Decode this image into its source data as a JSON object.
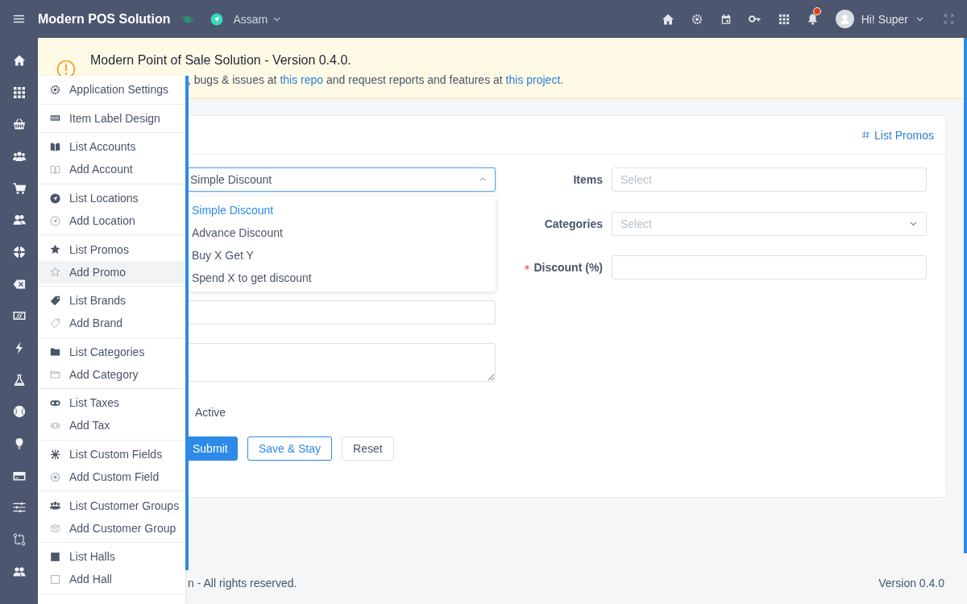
{
  "topbar": {
    "app_title": "Modern POS Solution",
    "location": "Assam",
    "user_greeting": "Hi! Super",
    "notifications_unread": true
  },
  "alert": {
    "title": "Modern Point of Sale Solution - Version 0.4.0.",
    "message": [
      {
        "kind": "text",
        "text": ", bugs & issues at "
      },
      {
        "kind": "link",
        "text": "this repo"
      },
      {
        "kind": "text",
        "text": " and request reports and features at "
      },
      {
        "kind": "link",
        "text": "this project"
      },
      {
        "kind": "text",
        "text": "."
      }
    ]
  },
  "menu": {
    "groups": [
      {
        "items": [
          {
            "label": "Application Settings",
            "selected": false
          }
        ]
      },
      {
        "items": [
          {
            "label": "Item Label Design",
            "selected": false
          }
        ]
      },
      {
        "items": [
          {
            "label": "List Accounts",
            "selected": false
          },
          {
            "label": "Add Account",
            "selected": false
          }
        ]
      },
      {
        "items": [
          {
            "label": "List Locations",
            "selected": false
          },
          {
            "label": "Add Location",
            "selected": false
          }
        ]
      },
      {
        "items": [
          {
            "label": "List Promos",
            "selected": false
          },
          {
            "label": "Add Promo",
            "selected": true
          }
        ]
      },
      {
        "items": [
          {
            "label": "List Brands",
            "selected": false
          },
          {
            "label": "Add Brand",
            "selected": false
          }
        ]
      },
      {
        "items": [
          {
            "label": "List Categories",
            "selected": false
          },
          {
            "label": "Add Category",
            "selected": false
          }
        ]
      },
      {
        "items": [
          {
            "label": "List Taxes",
            "selected": false
          },
          {
            "label": "Add Tax",
            "selected": false
          }
        ]
      },
      {
        "items": [
          {
            "label": "List Custom Fields",
            "selected": false
          },
          {
            "label": "Add Custom Field",
            "selected": false
          }
        ]
      },
      {
        "items": [
          {
            "label": "List Customer Groups",
            "selected": false
          },
          {
            "label": "Add Customer Group",
            "selected": false
          }
        ]
      },
      {
        "items": [
          {
            "label": "List Halls",
            "selected": false
          },
          {
            "label": "Add Hall",
            "selected": false
          }
        ]
      }
    ]
  },
  "card": {
    "header_link": "List Promos",
    "promo_type": {
      "value": "Simple Discount",
      "expanded": true,
      "options": [
        {
          "label": "Simple Discount",
          "selected": true
        },
        {
          "label": "Advance Discount",
          "selected": false
        },
        {
          "label": "Buy X Get Y",
          "selected": false
        },
        {
          "label": "Spend X to get discount",
          "selected": false
        }
      ]
    },
    "active_label": "Active",
    "buttons": [
      {
        "label": "Submit",
        "kind": "primary"
      },
      {
        "label": "Save & Stay",
        "kind": "outline"
      },
      {
        "label": "Reset",
        "kind": "default"
      }
    ],
    "right_fields": [
      {
        "label": "Items",
        "required": false,
        "kind": "multiselect",
        "placeholder": "Select"
      },
      {
        "label": "Categories",
        "required": false,
        "kind": "select",
        "placeholder": "Select"
      },
      {
        "label": "Discount (%)",
        "required": true,
        "kind": "input"
      }
    ]
  },
  "footer": {
    "copyright": "n - All rights reserved.",
    "version": "Version 0.4.0"
  }
}
